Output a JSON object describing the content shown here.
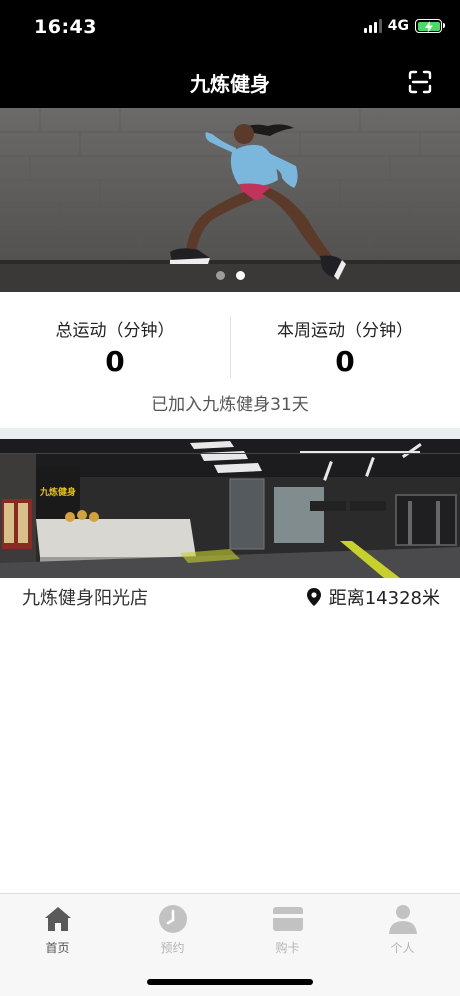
{
  "status_bar": {
    "time": "16:43",
    "network": "4G"
  },
  "header": {
    "title": "九炼健身"
  },
  "banner": {
    "slide_count": 2,
    "active_slide": 2
  },
  "stats": {
    "total_label": "总运动（分钟）",
    "total_value": "0",
    "weekly_label": "本周运动（分钟）",
    "weekly_value": "0",
    "joined_text": "已加入九炼健身31天"
  },
  "store": {
    "name": "九炼健身阳光店",
    "distance": "距离14328米",
    "sign_text": "九炼健身"
  },
  "tabs": [
    {
      "label": "首页",
      "icon": "home-icon",
      "active": true
    },
    {
      "label": "预约",
      "icon": "clock-icon",
      "active": false
    },
    {
      "label": "购卡",
      "icon": "card-icon",
      "active": false
    },
    {
      "label": "个人",
      "icon": "person-icon",
      "active": false
    }
  ],
  "colors": {
    "header_bg": "#000000",
    "battery": "#4cd964",
    "tab_active": "#555555",
    "tab_inactive": "#b5b5b5",
    "divider_band": "#e9eef1"
  }
}
